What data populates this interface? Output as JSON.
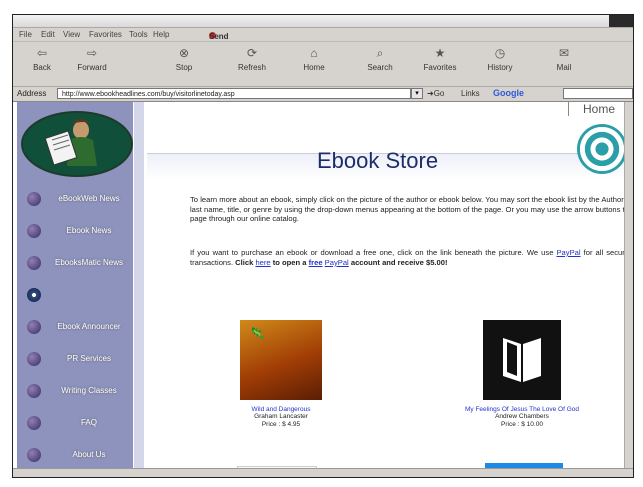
{
  "browser": {
    "menus": [
      "File",
      "Edit",
      "View",
      "Favorites",
      "Tools",
      "Help"
    ],
    "send_label": "Send",
    "toolbar": [
      {
        "label": "Back",
        "icon": "back-arrow-icon"
      },
      {
        "label": "Forward",
        "icon": "forward-arrow-icon"
      },
      {
        "label": "Stop",
        "icon": "stop-icon"
      },
      {
        "label": "Refresh",
        "icon": "refresh-icon"
      },
      {
        "label": "Home",
        "icon": "home-icon"
      },
      {
        "label": "Search",
        "icon": "search-icon"
      },
      {
        "label": "Favorites",
        "icon": "favorites-icon"
      },
      {
        "label": "History",
        "icon": "history-icon"
      },
      {
        "label": "Mail",
        "icon": "mail-icon"
      }
    ],
    "address_label": "Address",
    "address_url": "http://www.ebookheadlines.com/buy/visitorlinetoday.asp",
    "go_label": "Go",
    "links_label": "Links",
    "google_label": "Google"
  },
  "sidebar": {
    "items": [
      {
        "label": "eBookWeb News"
      },
      {
        "label": "Ebook News"
      },
      {
        "label": "EbooksMatic News"
      },
      {
        "label": ""
      },
      {
        "label": "Ebook Announcer"
      },
      {
        "label": "PR Services"
      },
      {
        "label": "Writing Classes"
      },
      {
        "label": "FAQ"
      },
      {
        "label": "About Us"
      }
    ]
  },
  "page": {
    "home_link": "Home",
    "title": "Ebook Store",
    "intro": "To learn more about an ebook, simply click on the picture of the author or ebook below. You may sort the ebook list by the Author's last name, title, or genre by using the drop-down menus appearing at the bottom of the page. Or you may use the arrow buttons to page through our online catalog.",
    "purchase_prefix": "If you want to purchase an ebook or download a free one, click on the link beneath the picture. We use ",
    "paypal_link": "PayPal",
    "purchase_middle": " for all secure transactions. ",
    "click_text": "Click ",
    "here_link": "here",
    "open_text": " to open a ",
    "free_text": "free",
    "paypal_link2": "PayPal",
    "account_text": " account and receive $5.00!"
  },
  "books": [
    {
      "title": "Wild and Dangerous",
      "author": "Graham Lancaster",
      "price": "Price : $ 4.95"
    },
    {
      "title": "My Feelings Of Jesus The Love Of God",
      "author": "Andrew Chambers",
      "price": "Price : $ 10.00"
    }
  ],
  "colors": {
    "sidebar": "#8d93bd",
    "title": "#1d2d6b",
    "link": "#2233cc",
    "accent_button": "#1e88e5"
  }
}
